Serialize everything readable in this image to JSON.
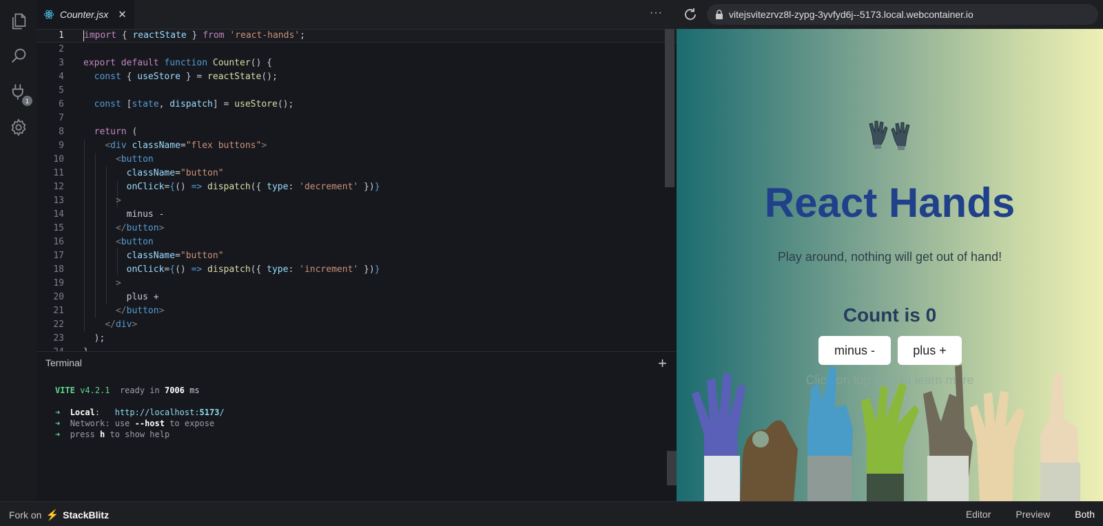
{
  "activity_bar": {
    "icons": [
      "files-icon",
      "search-icon",
      "plug-icon",
      "gear-icon"
    ],
    "badge_count": "1"
  },
  "editor": {
    "tab": {
      "filename": "Counter.jsx",
      "icon": "react-icon"
    },
    "more_label": "···"
  },
  "terminal": {
    "title": "Terminal",
    "lines": {
      "vite_name": "VITE",
      "vite_version": "v4.2.1",
      "ready_text": "ready in",
      "ready_ms": "7006",
      "ms": "ms",
      "local_label": "Local",
      "local_url_a": "http://localhost:",
      "local_url_port": "5173",
      "local_url_b": "/",
      "network_label": "Network",
      "network_text_a": ": use ",
      "network_flag": "--host",
      "network_text_b": " to expose",
      "help_a": "press ",
      "help_key": "h",
      "help_b": " to show help"
    }
  },
  "browser": {
    "url": "vitejsvitezrvz8l-zypg-3yvfyd6j--5173.local.webcontainer.io",
    "page": {
      "headline": "React Hands",
      "subtitle": "Play around, nothing will get out of hand!",
      "count_text": "Count is 0",
      "minus_label": "minus -",
      "plus_label": "plus +",
      "hint": "Click on top logo to learn more"
    }
  },
  "footer": {
    "fork_text": "Fork on",
    "brand": "StackBlitz",
    "views": [
      "Editor",
      "Preview",
      "Both"
    ],
    "active_view": "Both"
  },
  "colors": {
    "editor_bg": "#16181d",
    "headline": "#20408a",
    "accent": "#3ea6ff"
  }
}
